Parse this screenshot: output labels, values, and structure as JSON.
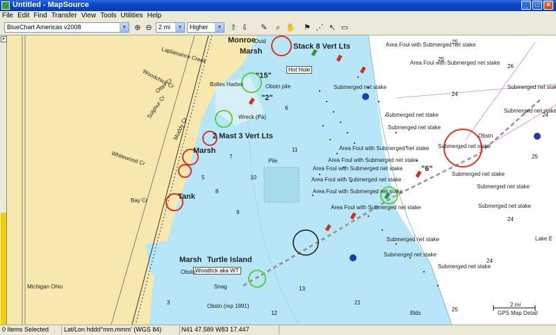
{
  "window": {
    "title": "Untitled - MapSource",
    "min": "_",
    "max": "□",
    "close": "×"
  },
  "menu": [
    "File",
    "Edit",
    "Find",
    "Transfer",
    "View",
    "Tools",
    "Utilities",
    "Help"
  ],
  "toolbar": {
    "product_select": "BlueChart Americas v2008",
    "zoom_select": "2 mi",
    "detail_select": "Higher"
  },
  "map": {
    "places": {
      "monroe": "Monroe",
      "marsh_top": "Marsh",
      "stack": "Stack 8 Vert Lts",
      "hot_hole": "Hot Hole",
      "fifteen": "\"15\"",
      "two": "\"2\"",
      "bolles_harbor": "Bolles Harbor",
      "obstn_pile": "Obstn pile",
      "wreck": "Wreck (Pa)",
      "mast": "2 Mast 3 Vert Lts",
      "marsh_mid": "Marsh",
      "pile": "Pile",
      "tank": "Tank",
      "bay_cr": "Bay Cr",
      "whitewood_cr": "Whitewood Cr",
      "turtle_island": "Turtle Island",
      "marsh_low": "Marsh",
      "woodtick": "Woodtick aka WT",
      "obstn_left": "Obstn",
      "snag": "Snag",
      "obstn_rep": "Obstn (rep 1991)",
      "michigan_ohio": "Michigan Ohio",
      "lake_erie": "Lake E",
      "blds": "Blds",
      "obstn_right": "Obstn",
      "six": "\"6\"",
      "laplaisance": "Laplaisance Creek",
      "woodchick": "Woodchick Cr",
      "otter": "Otter Cr",
      "sulphur": "Sulphur Cr",
      "muddy": "Muddy Cr",
      "ovid": "Ovid"
    },
    "area_foul": "Area Foul with Submerged net stake",
    "submerged": "Submerged net stake",
    "scale_label": "2 mi",
    "scale_caption": "GPS Map Detail"
  },
  "status": {
    "selected": "0 Items Selected",
    "format": "Lat/Lon hddd°mm.mmm' (WGS 84)",
    "position": "N41 47.589 W83 17.447"
  },
  "colors": {
    "water_deep": "#ffffff",
    "water_shallow": "#b6e6f7",
    "land": "#f7e8b0",
    "red_circle": "#e0301e",
    "green_circle": "#58d040"
  }
}
